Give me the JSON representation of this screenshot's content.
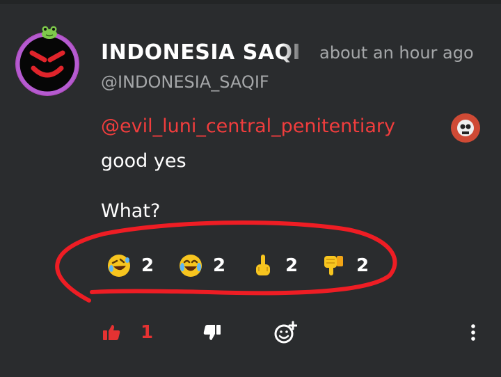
{
  "post": {
    "author_name": "INDONESIA SAQIF",
    "time": "about an hour ago",
    "handle": "@INDONESIA_SAQIF",
    "mention": "@evil_luni_central_penitentiary",
    "body_line1": "good yes",
    "body_line2": "What?"
  },
  "reactions": [
    {
      "icon": "rolling-laughing-emoji-icon",
      "count": "2"
    },
    {
      "icon": "tears-of-joy-emoji-icon",
      "count": "2"
    },
    {
      "icon": "middle-finger-emoji-icon",
      "count": "2"
    },
    {
      "icon": "thumbs-down-emoji-icon",
      "count": "2"
    }
  ],
  "actions": {
    "like_count": "1",
    "like_icon": "thumbs-up-icon",
    "dislike_icon": "thumbs-down-icon",
    "add_reaction_icon": "add-reaction-icon",
    "more_icon": "more-vertical-icon"
  },
  "colors": {
    "background": "#2a2c2e",
    "accent_red": "#e53232",
    "mention_red": "#f03d3d",
    "muted_text": "#a5a7a9"
  }
}
